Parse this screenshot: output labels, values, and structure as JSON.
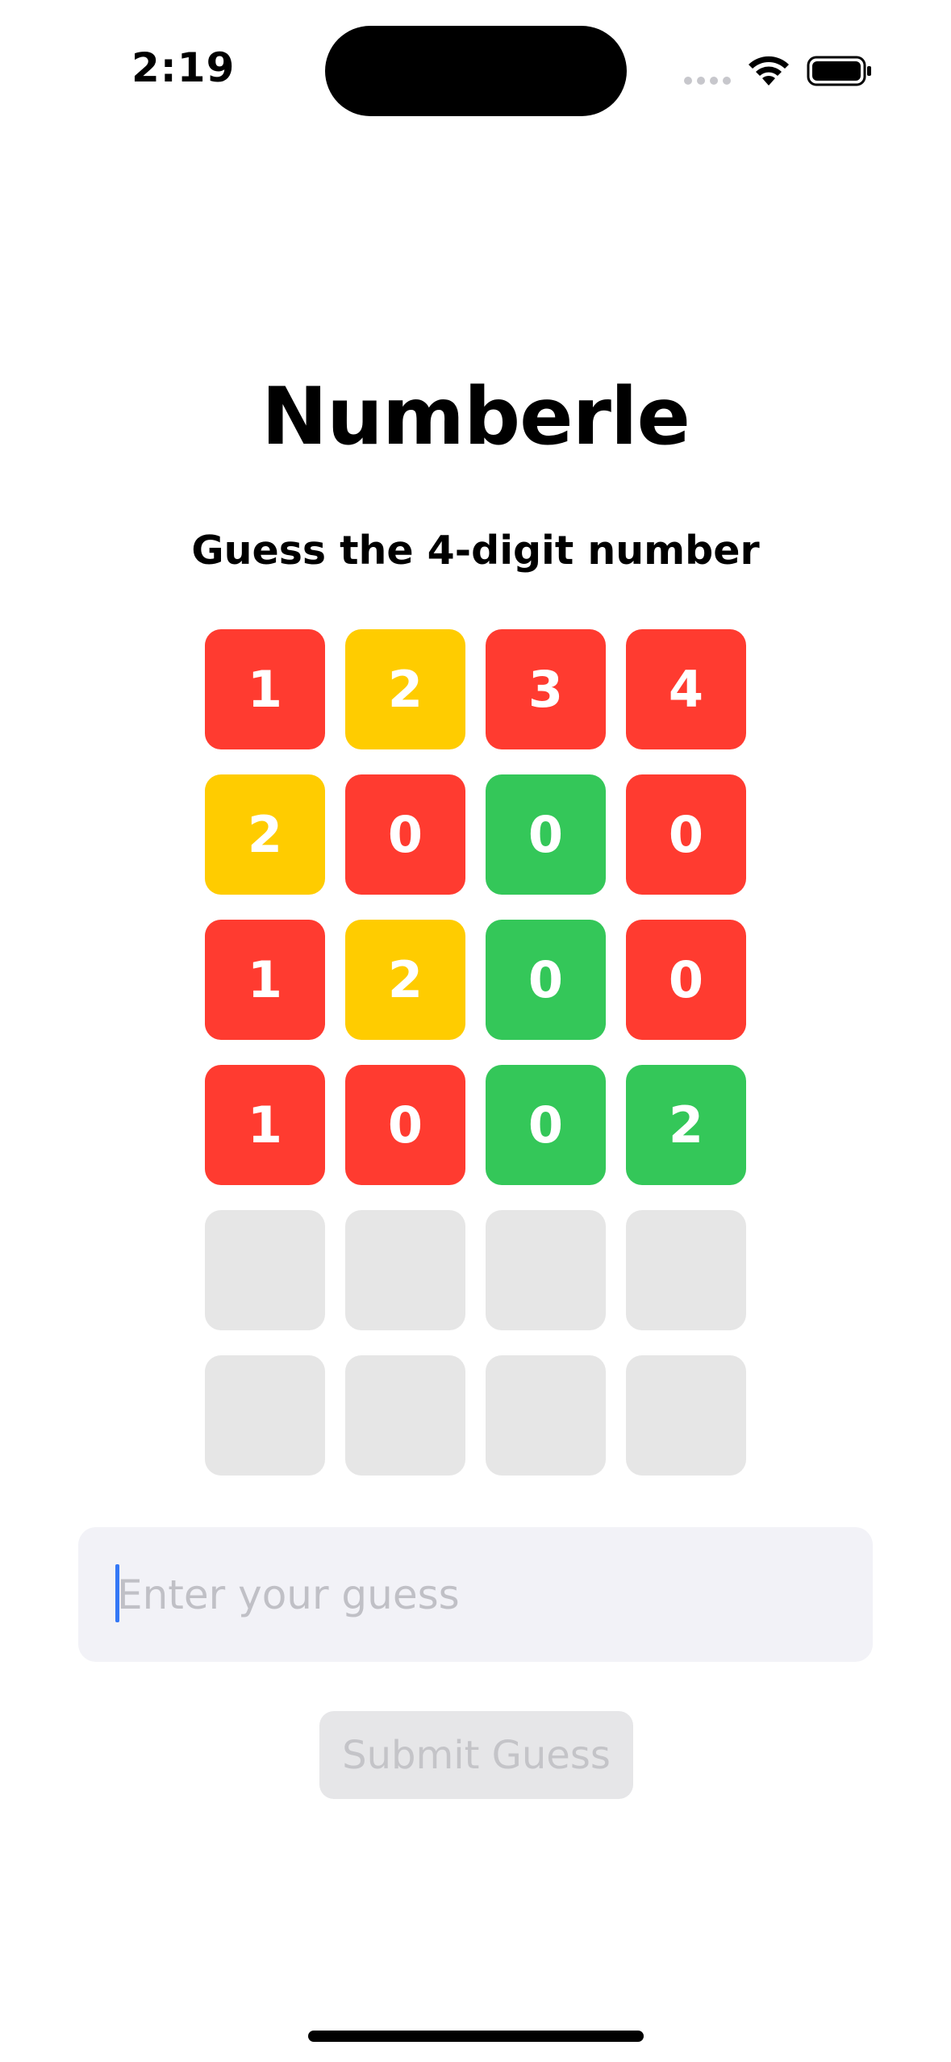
{
  "status_bar": {
    "time": "2:19"
  },
  "header": {
    "title": "Numberle",
    "subtitle": "Guess the 4-digit number"
  },
  "colors": {
    "miss": "#ff3b30",
    "present": "#ffcc00",
    "hit": "#34c759",
    "empty": "#e6e6e6"
  },
  "board": {
    "rows": [
      [
        {
          "digit": "1",
          "state": "red"
        },
        {
          "digit": "2",
          "state": "yellow"
        },
        {
          "digit": "3",
          "state": "red"
        },
        {
          "digit": "4",
          "state": "red"
        }
      ],
      [
        {
          "digit": "2",
          "state": "yellow"
        },
        {
          "digit": "0",
          "state": "red"
        },
        {
          "digit": "0",
          "state": "green"
        },
        {
          "digit": "0",
          "state": "red"
        }
      ],
      [
        {
          "digit": "1",
          "state": "red"
        },
        {
          "digit": "2",
          "state": "yellow"
        },
        {
          "digit": "0",
          "state": "green"
        },
        {
          "digit": "0",
          "state": "red"
        }
      ],
      [
        {
          "digit": "1",
          "state": "red"
        },
        {
          "digit": "0",
          "state": "red"
        },
        {
          "digit": "0",
          "state": "green"
        },
        {
          "digit": "2",
          "state": "green"
        }
      ],
      [
        {
          "digit": "",
          "state": "empty"
        },
        {
          "digit": "",
          "state": "empty"
        },
        {
          "digit": "",
          "state": "empty"
        },
        {
          "digit": "",
          "state": "empty"
        }
      ],
      [
        {
          "digit": "",
          "state": "empty"
        },
        {
          "digit": "",
          "state": "empty"
        },
        {
          "digit": "",
          "state": "empty"
        },
        {
          "digit": "",
          "state": "empty"
        }
      ]
    ]
  },
  "input": {
    "value": "",
    "placeholder": "Enter your guess"
  },
  "submit": {
    "label": "Submit Guess"
  }
}
